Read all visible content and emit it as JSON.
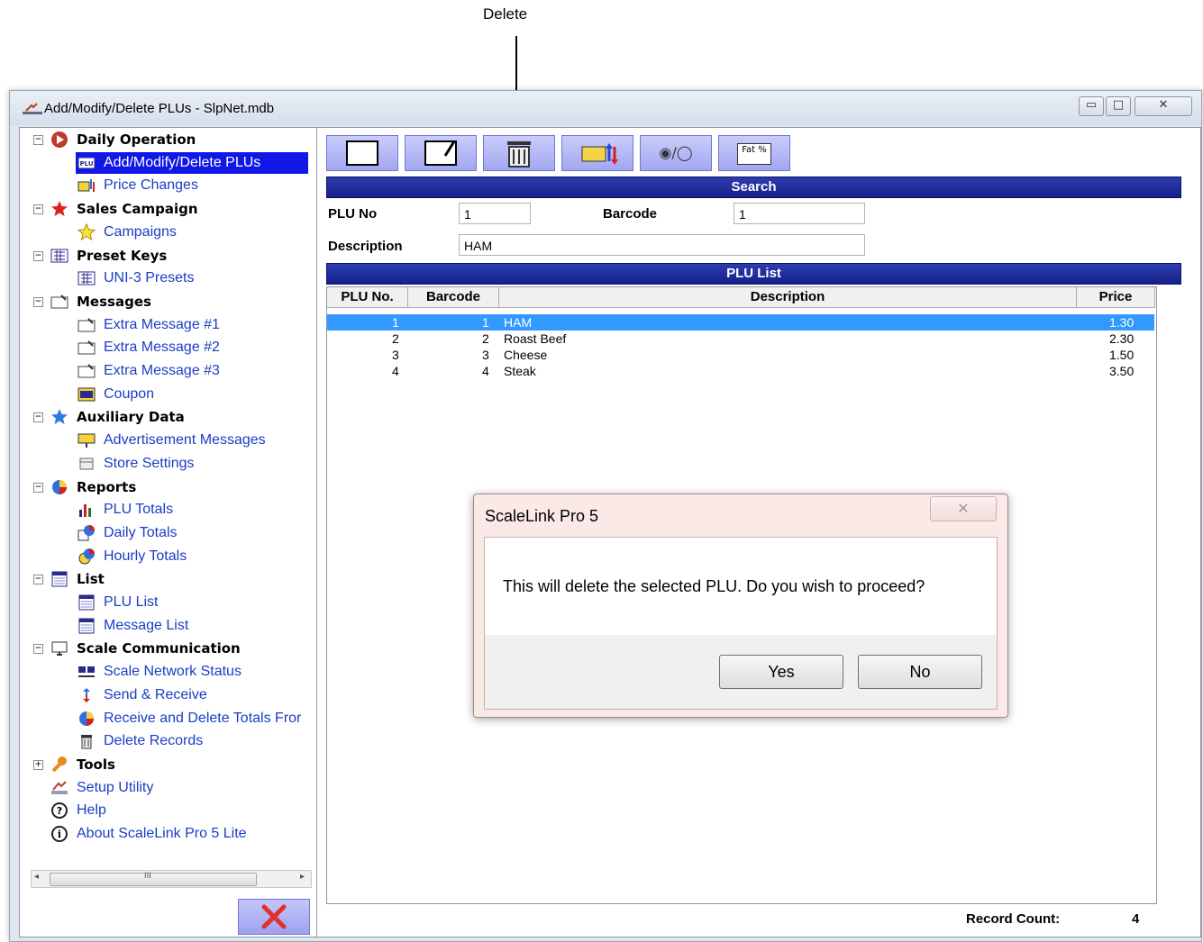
{
  "annotation": {
    "label": "Delete"
  },
  "window": {
    "title": "Add/Modify/Delete PLUs - SlpNet.mdb",
    "controls": {
      "minimize": "▭",
      "maximize": "□",
      "close": "✕"
    }
  },
  "sidebar": {
    "items": [
      {
        "label": "Daily Operation",
        "type": "category",
        "icon": "play-icon",
        "expander": "minus"
      },
      {
        "label": "Add/Modify/Delete PLUs",
        "type": "child",
        "icon": "plu-icon",
        "selected": true
      },
      {
        "label": "Price Changes",
        "type": "child",
        "icon": "price-change-icon"
      },
      {
        "label": "Sales Campaign",
        "type": "category",
        "icon": "star-red-icon",
        "expander": "minus"
      },
      {
        "label": "Campaigns",
        "type": "child",
        "icon": "star-yellow-icon"
      },
      {
        "label": "Preset Keys",
        "type": "category",
        "icon": "keypad-icon",
        "expander": "minus"
      },
      {
        "label": "UNI-3 Presets",
        "type": "child",
        "icon": "keypad-icon"
      },
      {
        "label": "Messages",
        "type": "category",
        "icon": "message-icon",
        "expander": "minus"
      },
      {
        "label": "Extra Message #1",
        "type": "child",
        "icon": "message-icon"
      },
      {
        "label": "Extra Message #2",
        "type": "child",
        "icon": "message-icon"
      },
      {
        "label": "Extra Message #3",
        "type": "child",
        "icon": "message-icon"
      },
      {
        "label": "Coupon",
        "type": "child",
        "icon": "coupon-icon"
      },
      {
        "label": "Auxiliary Data",
        "type": "category",
        "icon": "star-blue-icon",
        "expander": "minus"
      },
      {
        "label": "Advertisement Messages",
        "type": "child",
        "icon": "advert-icon"
      },
      {
        "label": "Store Settings",
        "type": "child",
        "icon": "store-icon"
      },
      {
        "label": "Reports",
        "type": "category",
        "icon": "pie-chart-icon",
        "expander": "minus"
      },
      {
        "label": "PLU Totals",
        "type": "child",
        "icon": "bar-chart-icon"
      },
      {
        "label": "Daily Totals",
        "type": "child",
        "icon": "calendar-chart-icon"
      },
      {
        "label": "Hourly Totals",
        "type": "child",
        "icon": "clock-chart-icon"
      },
      {
        "label": "List",
        "type": "category",
        "icon": "list-icon",
        "expander": "minus"
      },
      {
        "label": "PLU List",
        "type": "child",
        "icon": "list-icon"
      },
      {
        "label": "Message List",
        "type": "child",
        "icon": "list-icon"
      },
      {
        "label": "Scale Communication",
        "type": "category",
        "icon": "monitor-icon",
        "expander": "minus"
      },
      {
        "label": "Scale Network Status",
        "type": "child",
        "icon": "network-icon"
      },
      {
        "label": "Send & Receive",
        "type": "child",
        "icon": "transfer-icon"
      },
      {
        "label": "Receive and Delete Totals Fror",
        "type": "child",
        "icon": "pie-chart-icon"
      },
      {
        "label": "Delete Records",
        "type": "child",
        "icon": "trash-icon"
      },
      {
        "label": "Tools",
        "type": "category",
        "icon": "wrench-icon",
        "expander": "plus"
      },
      {
        "label": "Setup Utility",
        "type": "link",
        "icon": "setup-icon"
      },
      {
        "label": "Help",
        "type": "link",
        "icon": "help-icon"
      },
      {
        "label": "About ScaleLink Pro 5 Lite",
        "type": "link",
        "icon": "info-icon"
      }
    ],
    "scroll_grip": "III"
  },
  "toolbar": {
    "buttons": [
      {
        "icon": "new-document-icon"
      },
      {
        "icon": "edit-document-icon"
      },
      {
        "icon": "delete-trash-icon"
      },
      {
        "icon": "price-update-icon"
      },
      {
        "icon": "toggle-radio-icon",
        "text": "◉/◯"
      },
      {
        "icon": "nutrition-icon",
        "text": "Fat %"
      }
    ]
  },
  "search": {
    "title": "Search",
    "plu_no_label": "PLU No",
    "plu_no_value": "1",
    "barcode_label": "Barcode",
    "barcode_value": "1",
    "description_label": "Description",
    "description_value": "HAM"
  },
  "plu_list": {
    "title": "PLU List",
    "columns": [
      "PLU No.",
      "Barcode",
      "Description",
      "Price"
    ],
    "rows": [
      {
        "plu": "1",
        "barcode": "1",
        "description": "HAM",
        "price": "1.30",
        "selected": true
      },
      {
        "plu": "2",
        "barcode": "2",
        "description": "Roast Beef",
        "price": "2.30"
      },
      {
        "plu": "3",
        "barcode": "3",
        "description": "Cheese",
        "price": "1.50"
      },
      {
        "plu": "4",
        "barcode": "4",
        "description": "Steak",
        "price": "3.50"
      }
    ],
    "record_count_label": "Record Count:",
    "record_count": "4"
  },
  "dialog": {
    "title": "ScaleLink Pro 5",
    "message": "This will delete the selected PLU. Do you wish to proceed?",
    "yes_label": "Yes",
    "no_label": "No",
    "close_glyph": "✕"
  },
  "colors": {
    "selection": "#1017e6",
    "header_bar": "#1e2a9c",
    "link": "#1a3dc5",
    "row_selection": "#3399ff"
  }
}
